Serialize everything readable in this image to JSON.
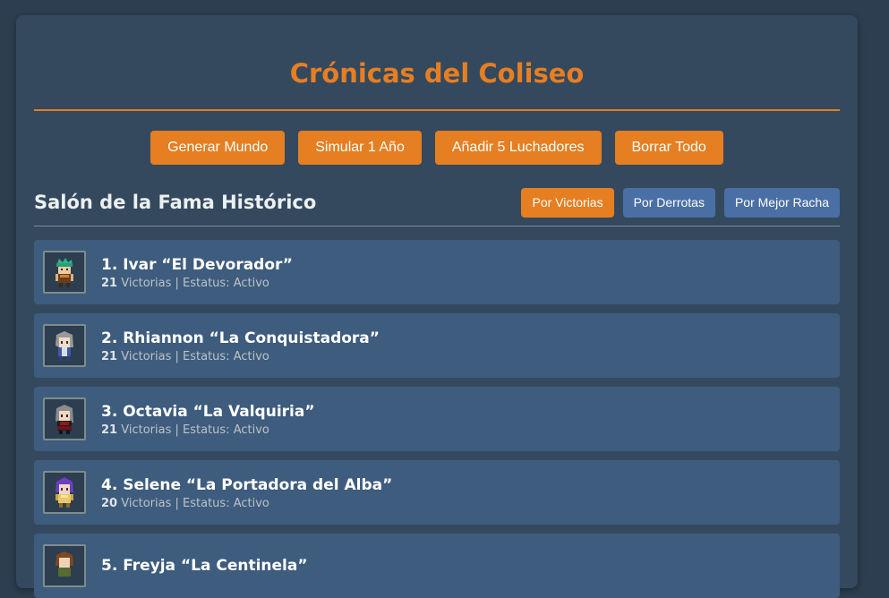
{
  "header": {
    "title": "Crónicas del Coliseo"
  },
  "toolbar": {
    "generate_label": "Generar Mundo",
    "simulate_label": "Simular 1 Año",
    "add_label": "Añadir 5 Luchadores",
    "clear_label": "Borrar Todo"
  },
  "hall_of_fame": {
    "title": "Salón de la Fama Histórico",
    "sort": {
      "victories": "Por Victorias",
      "defeats": "Por Derrotas",
      "streak": "Por Mejor Racha",
      "active": "victories"
    },
    "wins_suffix": "Victorias",
    "separator": "|",
    "status_label": "Estatus:",
    "entries": [
      {
        "name": "1. Ivar “El Devorador”",
        "wins": "21",
        "status": "Activo"
      },
      {
        "name": "2. Rhiannon “La Conquistadora”",
        "wins": "21",
        "status": "Activo"
      },
      {
        "name": "3. Octavia “La Valquiria”",
        "wins": "21",
        "status": "Activo"
      },
      {
        "name": "4. Selene “La Portadora del Alba”",
        "wins": "20",
        "status": "Activo"
      },
      {
        "name": "5. Freyja “La Centinela”",
        "wins": "",
        "status": ""
      }
    ]
  },
  "colors": {
    "accent": "#e67e22",
    "panel": "#34495e",
    "background": "#2c3e50",
    "row": "#3e5c7d",
    "sort_inactive": "#4a6fa5"
  },
  "icons": {
    "avatar_1": "fighter-sprite-green-hair",
    "avatar_2": "fighter-sprite-grey-hair-blue",
    "avatar_3": "fighter-sprite-grey-hair-red",
    "avatar_4": "fighter-sprite-purple-hair-gold",
    "avatar_5": "fighter-sprite-brown-hair"
  }
}
